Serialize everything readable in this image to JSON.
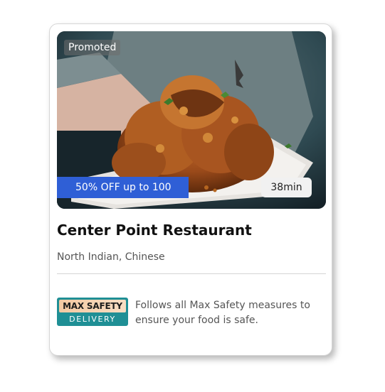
{
  "card": {
    "promoted_label": "Promoted",
    "offer": "50% OFF up to 100",
    "delivery_time": "38min",
    "restaurant_name": "Center Point Restaurant",
    "cuisines": "North Indian, Chinese",
    "safety_badge": {
      "top": "MAX SAFETY",
      "bottom": "DELIVERY"
    },
    "safety_text": "Follows all Max Safety measures to ensure your food is safe."
  },
  "colors": {
    "offer_bg": "#2f5fd6",
    "badge_teal": "#1f8f95",
    "badge_peach": "#f3c9a2"
  }
}
